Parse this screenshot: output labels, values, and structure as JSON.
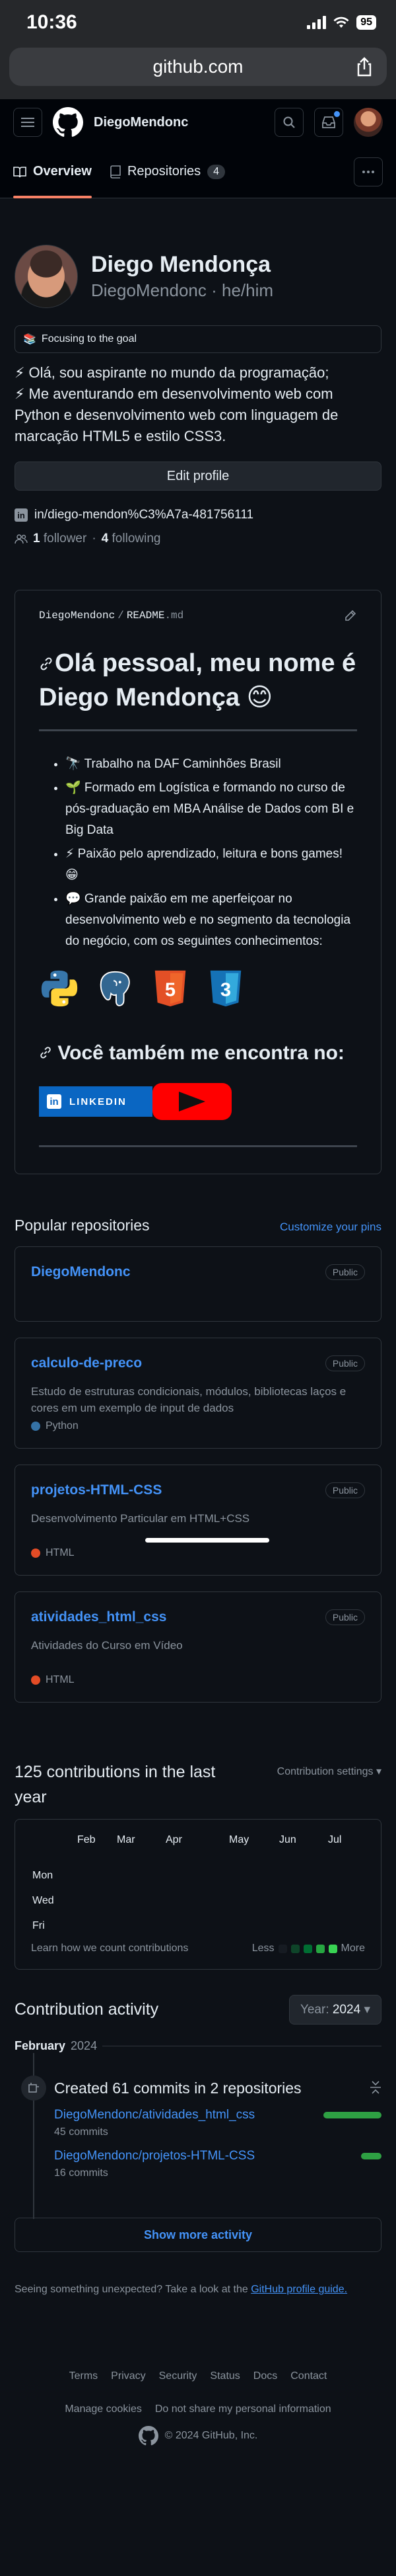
{
  "status_bar": {
    "time": "10:36",
    "battery": "95"
  },
  "browser": {
    "url": "github.com"
  },
  "header": {
    "username": "DiegoMendonc"
  },
  "tabs": [
    {
      "label": "Overview"
    },
    {
      "label": "Repositories",
      "count": "4"
    }
  ],
  "profile": {
    "name": "Diego Mendonça",
    "login": "DiegoMendonc",
    "pronouns": "he/him",
    "status": "Focusing to the goal",
    "status_emoji": "📚",
    "bio": [
      "⚡ Olá, sou aspirante no mundo da programação;",
      "⚡ Me aventurando em desenvolvimento web com Python e desenvolvimento web com linguagem de marcação HTML5 e estilo CSS3."
    ],
    "edit_button": "Edit profile",
    "linkedin": "in/diego-mendon%C3%A7a-481756111",
    "followers_count": "1",
    "followers_label": "follower",
    "following_count": "4",
    "following_label": "following"
  },
  "readme": {
    "owner": "DiegoMendonc",
    "file": "README",
    "ext": ".md",
    "heading": "Olá pessoal, meu nome é Diego Mendonça 😊",
    "items": [
      "🔭 Trabalho na DAF Caminhões Brasil",
      "🌱 Formado em Logística e formando no curso de pós-graduação em MBA Análise de Dados com BI e Big Data",
      "⚡ Paixão pelo aprendizado, leitura e bons games! 😁",
      "💬 Grande paixão em me aperfeiçoar no desenvolvimento web e no segmento da tecnologia do negócio, com os seguintes conhecimentos:"
    ],
    "tech_icons": [
      "python-icon",
      "postgresql-icon",
      "html5-icon",
      "css3-icon"
    ],
    "html5_label": "5",
    "css3_label": "3",
    "subheading": "Você também me encontra no:",
    "linkedin_badge": "LINKEDIN"
  },
  "popular": {
    "title": "Popular repositories",
    "customize": "Customize your pins",
    "repos": [
      {
        "name": "DiegoMendonc",
        "visibility": "Public",
        "description": "",
        "language": ""
      },
      {
        "name": "calculo-de-preco",
        "visibility": "Public",
        "description": "Estudo de estruturas condicionais, módulos, bibliotecas laços e cores em um exemplo de input de dados",
        "language": "Python",
        "lang_color": "#3572A5"
      },
      {
        "name": "projetos-HTML-CSS",
        "visibility": "Public",
        "description": "Desenvolvimento Particular em HTML+CSS",
        "language": "HTML",
        "lang_color": "#e34c26"
      },
      {
        "name": "atividades_html_css",
        "visibility": "Public",
        "description": "Atividades do Curso em Vídeo",
        "language": "HTML",
        "lang_color": "#e34c26"
      }
    ]
  },
  "contributions": {
    "title": "125 contributions in the last year",
    "settings": "Contribution settings ▾",
    "months": [
      "Feb",
      "Mar",
      "Apr",
      "May",
      "Jun",
      "Jul"
    ],
    "days": [
      "Mon",
      "Wed",
      "Fri"
    ],
    "learn": "Learn how we count contributions",
    "less": "Less",
    "more": "More",
    "legend_colors": [
      "#161b22",
      "#0e4429",
      "#006d32",
      "#26a641",
      "#39d353"
    ]
  },
  "activity": {
    "title": "Contribution activity",
    "year_label": "Year:",
    "year_value": "2024",
    "month": "February",
    "month_year": "2024",
    "commit_summary": "Created 61 commits in 2 repositories",
    "repos": [
      {
        "name": "DiegoMendonc/atividades_html_css",
        "commits": "45 commits",
        "bar": 0.8
      },
      {
        "name": "DiegoMendonc/projetos-HTML-CSS",
        "commits": "16 commits",
        "bar": 0.28
      }
    ],
    "show_more": "Show more activity",
    "feedback_text": "Seeing something unexpected? Take a look at the",
    "feedback_link": "GitHub profile guide."
  },
  "footer": {
    "links": [
      "Terms",
      "Privacy",
      "Security",
      "Status",
      "Docs",
      "Contact",
      "Manage cookies",
      "Do not share my personal information"
    ],
    "copyright": "© 2024 GitHub, Inc."
  }
}
